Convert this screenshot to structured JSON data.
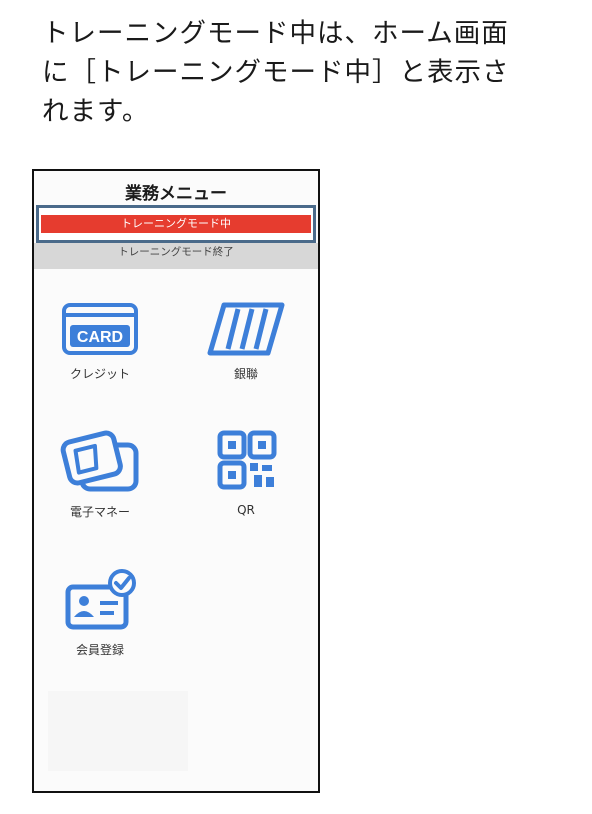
{
  "caption": {
    "line1": "トレーニングモード中は、ホーム画面",
    "line2": "に［トレーニングモード中］と表示さ",
    "line3": "れます。"
  },
  "screen": {
    "title": "業務メニュー",
    "mode_banner": "トレーニングモード中",
    "end_button": "トレーニングモード終了",
    "highlight_color": "#4a6a8a",
    "banner_color": "#e63c2f",
    "icon_color": "#3d7fd9"
  },
  "menu": [
    {
      "label": "クレジット",
      "icon": "card-icon",
      "icon_text": "CARD"
    },
    {
      "label": "銀聯",
      "icon": "unionpay-stripes-icon"
    },
    {
      "label": "電子マネー",
      "icon": "e-money-cards-icon"
    },
    {
      "label": "QR",
      "icon": "qr-code-icon"
    },
    {
      "label": "会員登録",
      "icon": "member-card-check-icon"
    }
  ]
}
